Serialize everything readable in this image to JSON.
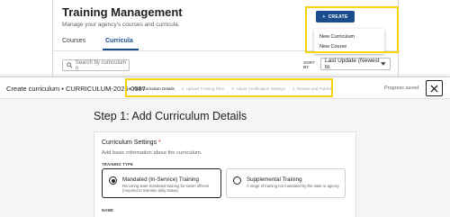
{
  "background": {
    "title": "Training Management",
    "subtitle": "Manage your agency's courses and curricula.",
    "tabs": [
      {
        "label": "Courses"
      },
      {
        "label": "Curricula"
      }
    ],
    "search_placeholder": "Search by curriculum n",
    "sort_label": "SORT BY",
    "sort_value": "Last Update (Newest to",
    "create_button": "CREATE",
    "create_menu": [
      "New Curriculum",
      "New Course"
    ]
  },
  "modal": {
    "title": "Create curriculum • CURRICULUM-2025-0587",
    "steps": [
      {
        "label": "1. Add Curriculum Details"
      },
      {
        "label": "2. Upload Training Files"
      },
      {
        "label": "3. Adjust Certification Settings"
      },
      {
        "label": "4. Review and Publish"
      }
    ],
    "progress_status": "Progress saved",
    "step_heading": "Step 1: Add Curriculum Details",
    "settings": {
      "title": "Curriculum Settings",
      "required_mark": "*",
      "description": "Add basic information about the curriculum.",
      "training_type_label": "TRAINING TYPE",
      "options": [
        {
          "title": "Mandated (In-Service) Training",
          "description": "Recurring state-mandated training for sworn officers (required to maintain daily status)",
          "selected": true
        },
        {
          "title": "Supplemental Training",
          "description": "A range of training not mandated by the state or agency",
          "selected": false
        }
      ],
      "name_label": "NAME"
    }
  },
  "colors": {
    "brand_blue": "#1a4d8c",
    "highlight_yellow": "#f5d40f",
    "required_red": "#d93025"
  }
}
